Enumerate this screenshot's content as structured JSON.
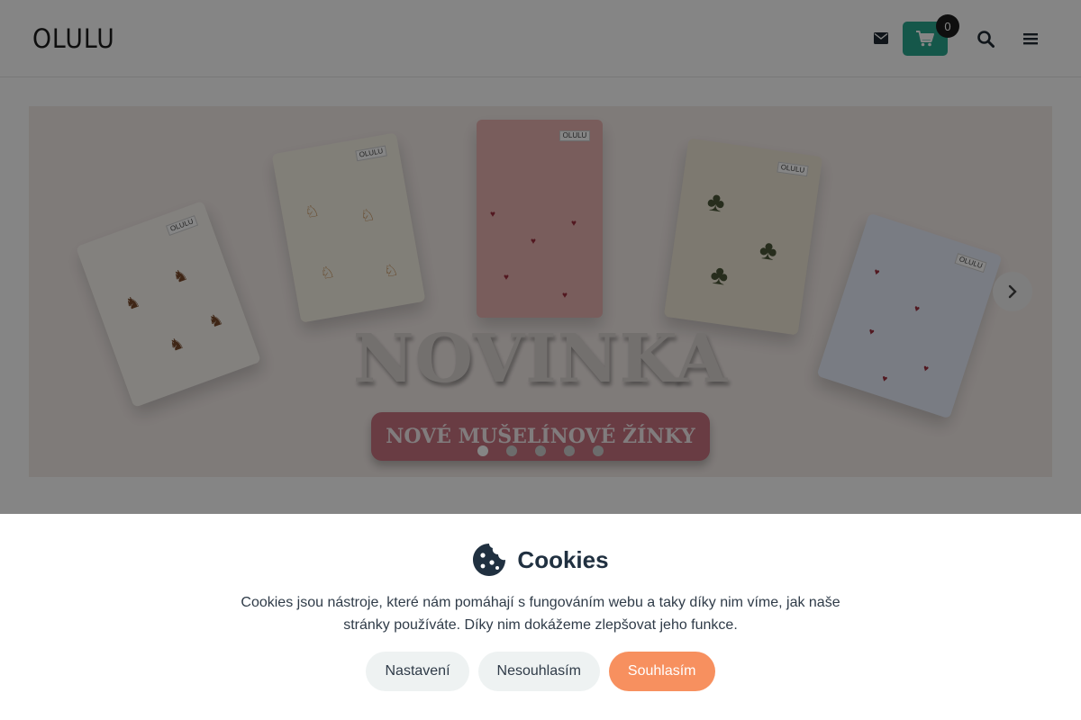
{
  "header": {
    "logo": "OLULU",
    "cart_count": "0",
    "colors": {
      "cart_button": "#2aa78f",
      "badge": "#1d1d1d"
    },
    "icons": [
      "envelope-icon",
      "shopping-cart-icon",
      "search-icon",
      "hamburger-menu-icon"
    ]
  },
  "carousel": {
    "headline": "NOVINKA",
    "subheadline": "NOVÉ MUŠELÍNOVÉ ŽÍNKY",
    "slide_label": "OLULU",
    "slide_count": 5,
    "active_slide": 1,
    "icons": [
      "chevron-right-icon"
    ]
  },
  "cookie_bar": {
    "title": "Cookies",
    "text": "Cookies jsou nástroje, které nám pomáhají s fungováním webu a taky díky nim víme, jak naše stránky používáte. Díky nim dokážeme zlepšovat jeho funkce.",
    "buttons": {
      "settings": "Nastavení",
      "reject": "Nesouhlasím",
      "accept": "Souhlasím"
    },
    "colors": {
      "accept": "#f7905f",
      "secondary": "#eef2f2"
    },
    "icons": [
      "cookie-icon"
    ]
  }
}
